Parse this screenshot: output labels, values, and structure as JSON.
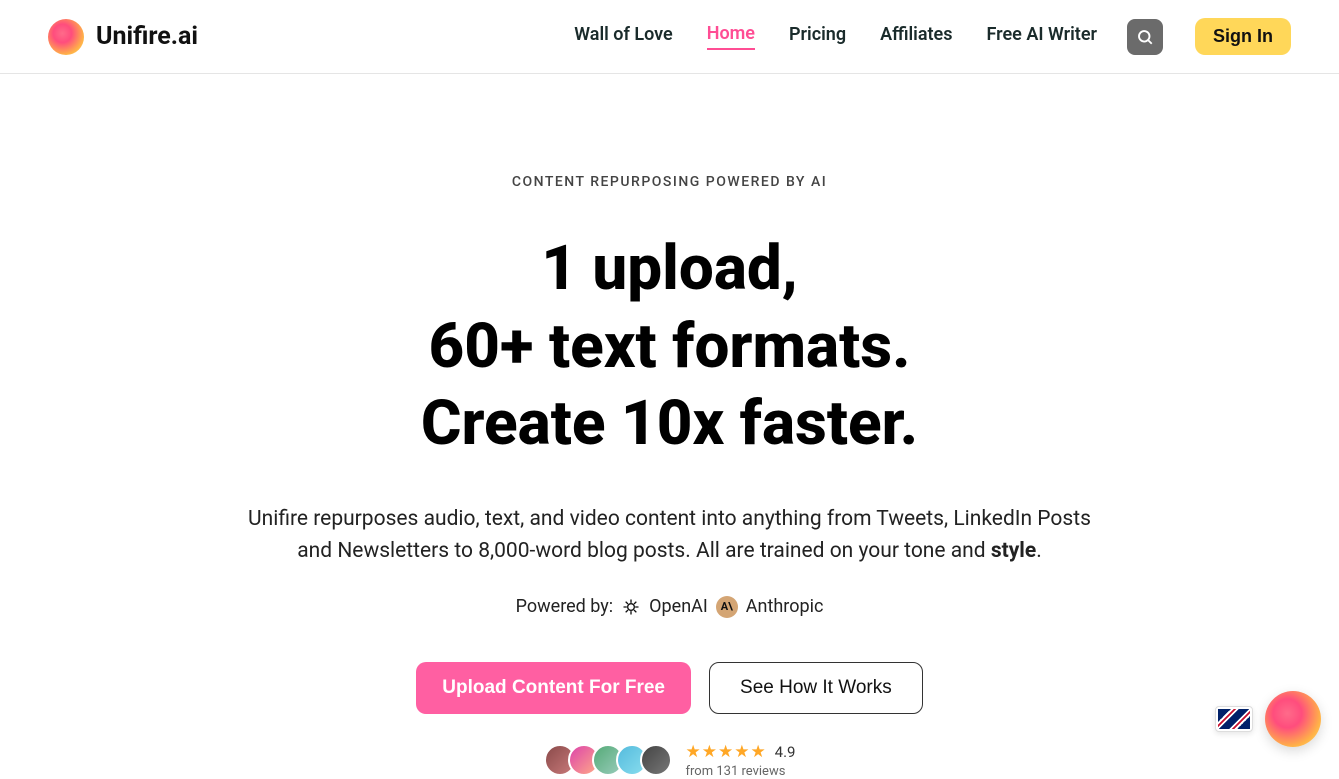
{
  "brand": {
    "name": "Unifire.ai"
  },
  "nav": {
    "items": [
      {
        "label": "Wall of Love",
        "active": false
      },
      {
        "label": "Home",
        "active": true
      },
      {
        "label": "Pricing",
        "active": false
      },
      {
        "label": "Affiliates",
        "active": false
      },
      {
        "label": "Free AI Writer",
        "active": false
      }
    ],
    "signin": "Sign In"
  },
  "hero": {
    "eyebrow": "CONTENT REPURPOSING POWERED BY AI",
    "headline_l1": "1 upload,",
    "headline_l2": "60+ text formats.",
    "headline_l3": "Create 10x faster.",
    "subhead_plain": "Unifire repurposes audio, text, and video content into anything from Tweets, LinkedIn Posts and Newsletters to 8,000-word blog posts. All are trained on your tone and ",
    "subhead_bold": "style",
    "subhead_tail": ".",
    "powered_prefix": "Powered by:",
    "powered_openai": "OpenAI",
    "powered_anthropic": "Anthropic",
    "anthropic_icon_text": "A\\",
    "cta_primary": "Upload Content For Free",
    "cta_secondary": "See How It Works"
  },
  "social": {
    "rating": "4.9",
    "reviews_prefix": "from ",
    "reviews_count": "131",
    "reviews_suffix": " reviews"
  }
}
